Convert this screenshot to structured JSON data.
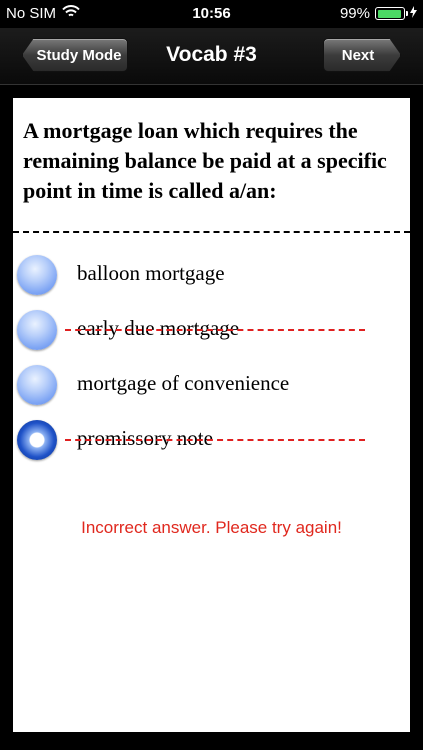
{
  "status_bar": {
    "carrier": "No SIM",
    "time": "10:56",
    "battery": "99%",
    "battery_level": 0.99
  },
  "nav": {
    "back_label": "Study Mode",
    "title": "Vocab #3",
    "next_label": "Next"
  },
  "question": "A mortgage loan which requires the remaining balance be paid at a specific point in time is called a/an:",
  "options": [
    {
      "label": "balloon mortgage",
      "struck": false,
      "selected": false
    },
    {
      "label": "early due mortgage",
      "struck": true,
      "selected": false
    },
    {
      "label": "mortgage of convenience",
      "struck": false,
      "selected": false
    },
    {
      "label": "promissory note",
      "struck": true,
      "selected": true
    }
  ],
  "feedback": "Incorrect answer. Please try again!",
  "colors": {
    "error": "#e0281e",
    "strike": "#e02020",
    "battery": "#4cd964"
  }
}
